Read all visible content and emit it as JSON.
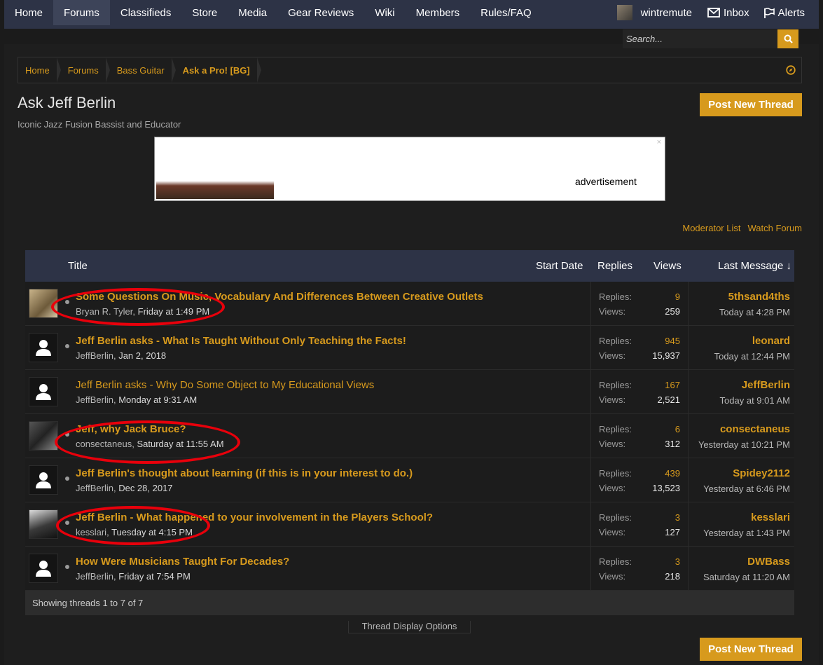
{
  "nav": {
    "tabs": [
      "Home",
      "Forums",
      "Classifieds",
      "Store",
      "Media",
      "Gear Reviews",
      "Wiki",
      "Members",
      "Rules/FAQ"
    ],
    "active_tab": "Forums",
    "username": "wintremute",
    "inbox_label": "Inbox",
    "alerts_label": "Alerts"
  },
  "search": {
    "placeholder": "Search..."
  },
  "breadcrumb": [
    "Home",
    "Forums",
    "Bass Guitar",
    "Ask a Pro! [BG]"
  ],
  "page": {
    "title": "Ask Jeff Berlin",
    "description": "Iconic Jazz Fusion Bassist and Educator",
    "post_button": "Post New Thread"
  },
  "ad": {
    "label": "advertisement",
    "close": "×"
  },
  "forum_links": {
    "moderator_list": "Moderator List",
    "watch_forum": "Watch Forum"
  },
  "list_header": {
    "title": "Title",
    "start_date": "Start Date",
    "replies": "Replies",
    "views": "Views",
    "last_message": "Last Message ↓"
  },
  "stat_labels": {
    "replies": "Replies:",
    "views": "Views:"
  },
  "threads": [
    {
      "title": "Some Questions On Music, Vocabulary And Differences Between Creative Outlets",
      "author": "Bryan R. Tyler",
      "date": "Friday at 1:49 PM",
      "replies": "9",
      "views": "259",
      "last_user": "5thsand4ths",
      "last_time": "Today at 4:28 PM",
      "unread": true,
      "avatar": "photo"
    },
    {
      "title": "Jeff Berlin asks - What Is Taught Without Only Teaching the Facts!",
      "author": "JeffBerlin",
      "date": "Jan 2, 2018",
      "replies": "945",
      "views": "15,937",
      "last_user": "leonard",
      "last_time": "Today at 12:44 PM",
      "unread": true,
      "avatar": "default"
    },
    {
      "title": "Jeff Berlin asks - Why Do Some Object to My Educational Views",
      "author": "JeffBerlin",
      "date": "Monday at 9:31 AM",
      "replies": "167",
      "views": "2,521",
      "last_user": "JeffBerlin",
      "last_time": "Today at 9:01 AM",
      "unread": false,
      "avatar": "default"
    },
    {
      "title": "Jeff, why Jack Bruce?",
      "author": "consectaneus",
      "date": "Saturday at 11:55 AM",
      "replies": "6",
      "views": "312",
      "last_user": "consectaneus",
      "last_time": "Yesterday at 10:21 PM",
      "unread": true,
      "avatar": "photo"
    },
    {
      "title": "Jeff Berlin's thought about learning (if this is in your interest to do.)",
      "author": "JeffBerlin",
      "date": "Dec 28, 2017",
      "replies": "439",
      "views": "13,523",
      "last_user": "Spidey2112",
      "last_time": "Yesterday at 6:46 PM",
      "unread": true,
      "avatar": "default"
    },
    {
      "title": "Jeff Berlin - What happened to your involvement in the Players School?",
      "author": "kesslari",
      "date": "Tuesday at 4:15 PM",
      "replies": "3",
      "views": "127",
      "last_user": "kesslari",
      "last_time": "Yesterday at 1:43 PM",
      "unread": true,
      "avatar": "photo"
    },
    {
      "title": "How Were Musicians Taught For Decades?",
      "author": "JeffBerlin",
      "date": "Friday at 7:54 PM",
      "replies": "3",
      "views": "218",
      "last_user": "DWBass",
      "last_time": "Saturday at 11:20 AM",
      "unread": true,
      "avatar": "default"
    }
  ],
  "footer": {
    "showing": "Showing threads 1 to 7 of 7",
    "display_options": "Thread Display Options"
  },
  "colors": {
    "accent": "#d79a1d",
    "nav_bg": "#2d3346",
    "annotation": "#e8000b"
  },
  "icons": [
    "search-icon",
    "envelope-icon",
    "flag-icon",
    "compass-icon",
    "default-user-icon"
  ]
}
